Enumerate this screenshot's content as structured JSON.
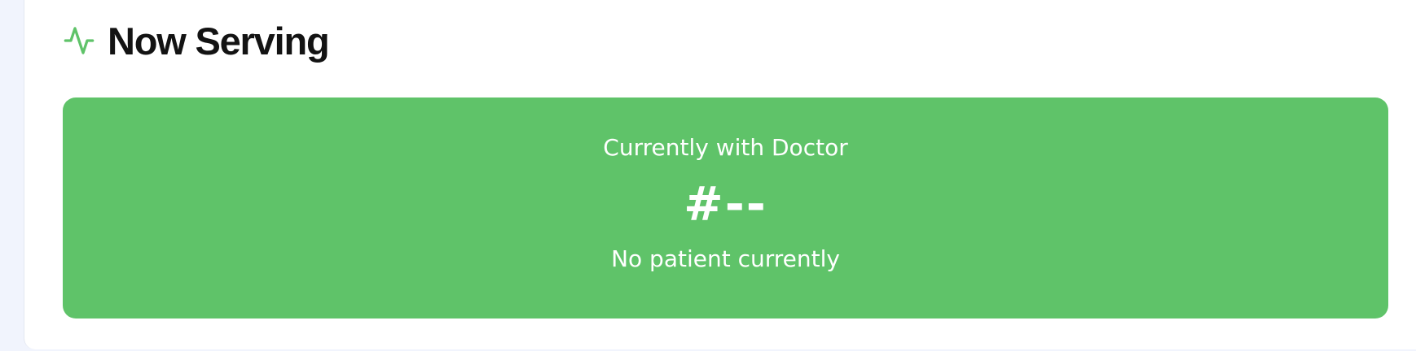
{
  "section": {
    "icon": "activity-pulse-icon",
    "title": "Now Serving"
  },
  "serving": {
    "label": "Currently with Doctor",
    "ticket": "#--",
    "status": "No patient currently"
  },
  "colors": {
    "accent": "#5fc369",
    "title_text": "#131313",
    "page_background": "#f1f4fd",
    "card_background": "#ffffff"
  }
}
